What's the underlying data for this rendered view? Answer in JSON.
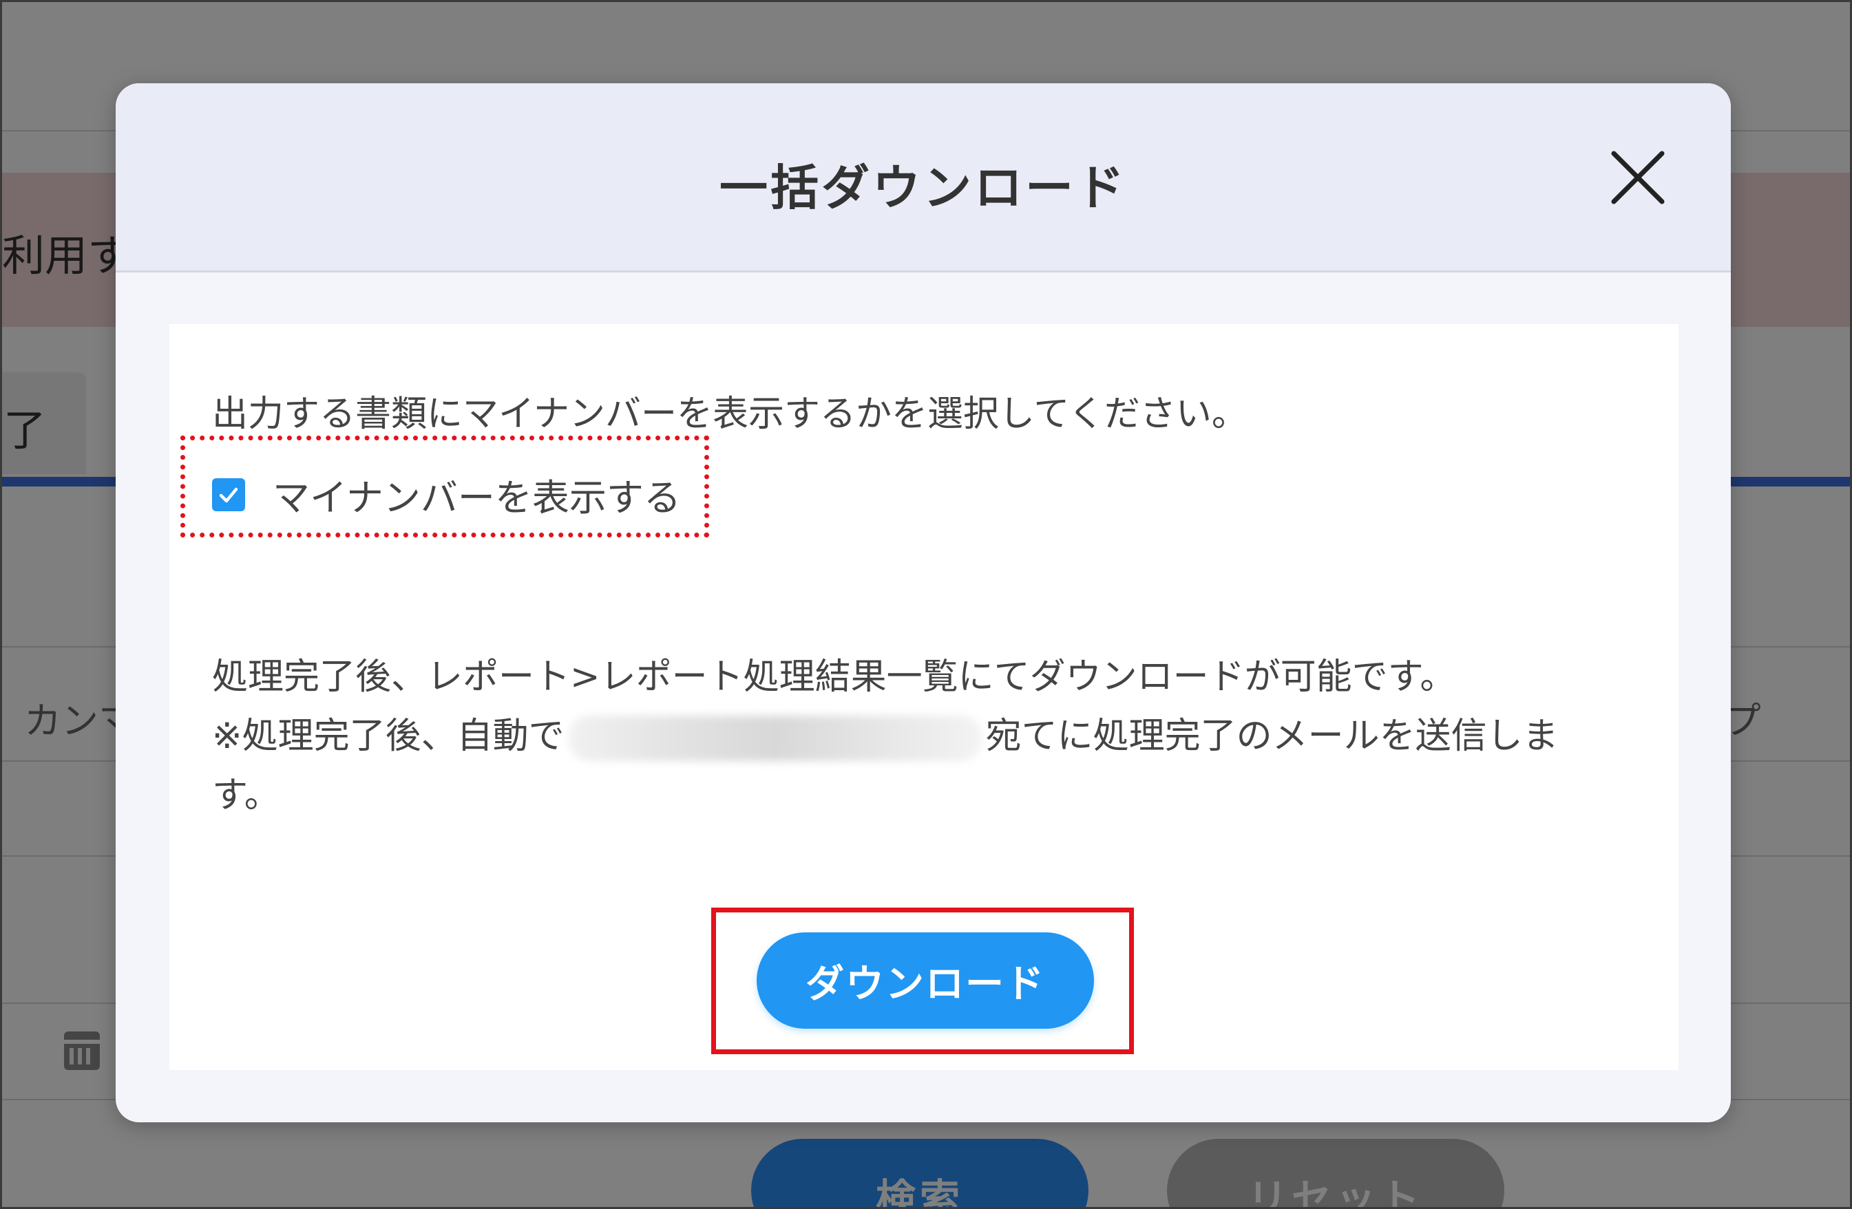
{
  "background": {
    "alert_text": "利用す",
    "tab_text": "了",
    "left_text": "カンマ",
    "right_text": "ープ",
    "search_label": "検索",
    "reset_label": "リセット"
  },
  "modal": {
    "title": "一括ダウンロード",
    "description": "出力する書類にマイナンバーを表示するかを選択してください。",
    "checkbox": {
      "label": "マイナンバーを表示する",
      "checked": true
    },
    "info_line1": "処理完了後、レポート>レポート処理結果一覧にてダウンロードが可能です。",
    "info_line2_prefix": "※処理完了後、自動で",
    "info_line2_suffix": "宛てに処理完了のメールを送信しま",
    "info_line3": "す。",
    "download_label": "ダウンロード"
  },
  "colors": {
    "accent": "#2196f3",
    "highlight": "#e3121b",
    "header_bg": "#e9ebf7"
  },
  "icons": {
    "close": "close-icon",
    "check": "check-icon",
    "calendar": "calendar-icon"
  }
}
